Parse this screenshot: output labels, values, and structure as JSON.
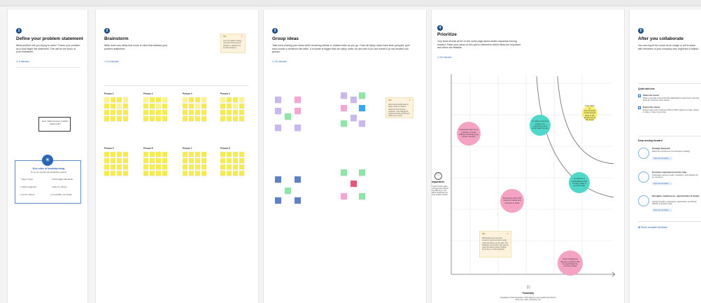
{
  "panel1": {
    "number": "1",
    "title": "Define your problem statement",
    "desc": "What problem are you trying to solve? Frame your problem as a How Might We statement. This will be the focus of your brainstorm.",
    "time": "5 minutes",
    "card_text": "How might we [your problem statement]?",
    "rules_title": "Key rules of brainstorming",
    "rules_sub": "To run an smooth and productive session",
    "rules": [
      "Stay in topic.",
      "Encourage wild ideas.",
      "Defer judgment.",
      "Listen to others.",
      "Go for volume.",
      "If possible, be visual."
    ]
  },
  "panel2": {
    "number": "2",
    "title": "Brainstorm",
    "desc": "Write down any ideas that come to mind that address your problem statement.",
    "time": "10 minutes",
    "tip_label": "TIP",
    "tip_text": "You can select a sticky note and hit the pencil [switch to sketch] icon to start drawing!",
    "persons": [
      "Person 1",
      "Person 2",
      "Person 3",
      "Person 4",
      "Person 5",
      "Person 6",
      "Person 7",
      "Person 8"
    ]
  },
  "panel3": {
    "number": "3",
    "title": "Group ideas",
    "desc": "Take turns sharing your ideas while clustering similar or related notes as you go. Once all sticky notes have been grouped, give each cluster a sentence-like label. If a cluster is bigger than six sticky notes, try and see if you and break it up into smaller sub-groups.",
    "time": "20 minutes",
    "tip_label": "TIP",
    "tip_text": "Add customizable tags to sticky notes to make it easier to find, browse, organize, and categorize important ideas as themes within your mural."
  },
  "panel4": {
    "number": "4",
    "title": "Prioritize",
    "desc": "Your team should all be on the same page about what's important moving forward. Place your ideas on this grid to determine which ideas are important and which are feasible.",
    "time": "20 minutes",
    "y_axis_title": "Importance",
    "y_axis_desc": "If each of these tasks could get done without any difficulty or cost, which would have the most positive impact?",
    "x_axis_title": "Feasibility",
    "x_axis_desc": "Regardless of their importance, which tasks are more feasible than others? (Cost, time, effort, complexity, etc.)",
    "circles": [
      "Customers want us to prioritize a mode without contacting any of their vendors",
      "An idea to use AI is small in our experience and could keep the day",
      "A key value to communicate is planned as clear in the simple test of the brand",
      "To build on a sustainable model to keep make a common app",
      "Remember that UTE looks for simple and common in mass",
      "Some intelligence choose to dismiss this for specifically the common points"
    ],
    "tip_label": "TIP",
    "tip_text": "Participants can use their cursors to point at where sticky notes should go on the grid. The facilitator can confirm the spot by using the laser pointer holding the H key on their keyboard."
  },
  "panel5": {
    "number": "5",
    "title": "After you collaborate",
    "desc": "You can export the mural as an image or pdf to share with members of your company who might find it helpful.",
    "quick_title": "Quick add-ons",
    "quick": [
      {
        "title": "Share the mural",
        "text": "Share a view link to the mural with stakeholders to keep them in the loop about the outcomes of the session."
      },
      {
        "title": "Export the mural",
        "text": "Export a copy of the mural as a PNG or PDF to attach to emails, include in slides, or save in your drive."
      }
    ],
    "keep_title": "Keep moving forward",
    "keep": [
      {
        "title": "Strategy blueprint",
        "text": "Define the components of a new idea or strategy.",
        "link": "Open the template"
      },
      {
        "title": "Customer experience journey map",
        "text": "Understand customer needs, motivations, and obstacles for an experience.",
        "link": "Open the template"
      },
      {
        "title": "Strengths, weaknesses, opportunities & threats",
        "text": "Identify strengths, weaknesses, opportunities, and threats (SWOT) to develop a plan.",
        "link": "Open the template"
      }
    ],
    "feedback": "Share template feedback"
  },
  "colors": {
    "accent": "#1a4f8b",
    "sticky_yellow": "#f6ec4f",
    "pink": "#f4a3c3",
    "teal": "#4fd8c8",
    "light_yellow": "#f6ef72"
  }
}
